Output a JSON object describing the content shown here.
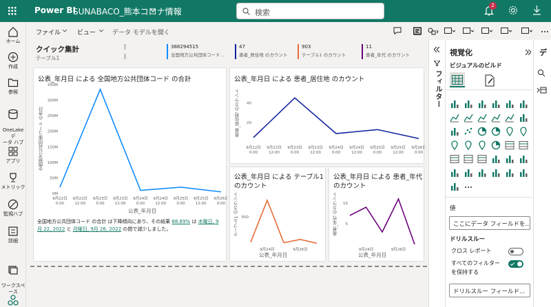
{
  "topbar": {
    "app_name": "Power BI",
    "report_name": "SUNABACO_熊本コロナ情報",
    "search_placeholder": "検索",
    "notification_count": "2"
  },
  "rail": {
    "items": [
      {
        "label": "ホーム"
      },
      {
        "label": "作成"
      },
      {
        "label": "参照"
      },
      {
        "label": "OneLake デ\nータ ハブ"
      },
      {
        "label": "アプリ"
      },
      {
        "label": "メトリック"
      },
      {
        "label": "監視ハブ"
      },
      {
        "label": "詳細"
      },
      {
        "label": "ワークスペ\nース"
      }
    ]
  },
  "cmdbar": {
    "file": "ファイル",
    "view": "ビュー",
    "model": "データ モデルを開く"
  },
  "quick": {
    "title": "クイック集計",
    "subtitle": "テーブル1",
    "kpis": [
      {
        "value": "388294515",
        "label": "全国地方公共団体コード...",
        "color": "#118dff"
      },
      {
        "value": "47",
        "label": "患者_居住地 のカウント",
        "color": "#12239e"
      },
      {
        "value": "903",
        "label": "テーブル1 のカウント",
        "color": "#e66c37"
      },
      {
        "value": "11",
        "label": "患者_年代 のカウント",
        "color": "#6b007b"
      }
    ]
  },
  "charts": {
    "c1": {
      "title": "公表_年月日 による 全国地方公共団体コード の合計",
      "ylabel": "全国地方公共団体コード の合計",
      "xlabel": "公表_年月日",
      "yticks": [
        "350M",
        "300M",
        "250M",
        "200M",
        "150M",
        "100M",
        "50M",
        "0M"
      ],
      "xticks": [
        "9月22日\n0:00",
        "9月22日\n12:00",
        "9月23日\n0:00",
        "9月23日\n12:00",
        "9月24日\n0:00",
        "9月24日\n12:00",
        "9月25日\n0:00",
        "9月25日\n12:00",
        "9月26日\n0:00"
      ]
    },
    "c2": {
      "title": "公表_年月日 による 患者_居住地 のカウント",
      "ylabel": "患者_居住地 のカウント",
      "yticks": [
        "40",
        "20"
      ],
      "xticks": [
        "9月22日\n0:00",
        "9月22日\n12:00",
        "9月23日\n0:00",
        "9月23日\n12:00",
        "9月24日\n0:00",
        "9月24日\n12:00",
        "9月25日\n0:00",
        "9月25日\n12:00",
        "9月26日\n0:00"
      ]
    },
    "c3": {
      "title1": "公表_年月日 による テーブル1",
      "title2": "のカウント",
      "ylabel": "テーブル1 のカウント",
      "xlabel": "公表_年月日",
      "yticks": [
        "500"
      ],
      "xticks": [
        "9月24日",
        "9月26日"
      ]
    },
    "c4": {
      "title1": "公表_年月日 による 患者_年代",
      "title2": "のカウント",
      "ylabel": "患者_年代 のカウント",
      "xlabel": "公表_年月日",
      "yticks": [
        "10",
        "5"
      ],
      "xticks": [
        "9月24日",
        "9月26日"
      ]
    }
  },
  "narrative": {
    "p1": "全国地方公共団体コード の合計 は下降傾向にあり、その結果",
    "pct": "88.89%",
    "p2": "は",
    "d1": "木曜日, 9月 22, 2022",
    "p3": "と",
    "d2": "月曜日, 9月 26, 2022",
    "p4": "の間で減少しました。"
  },
  "filterpane": {
    "label": "フィルター"
  },
  "viz": {
    "title": "視覚化",
    "build": "ビジュアルのビルド",
    "values": "値",
    "values_field": "ここにデータ フィールドを...",
    "drill": "ドリルスルー",
    "cross": "クロス レポート",
    "keepall1": "すべてのフィルター",
    "keepall2": "を保持する",
    "drill_field": "ドリルスルー フィールド...",
    "data_tab": "デ"
  },
  "chart_data": [
    {
      "type": "line",
      "title": "公表_年月日 による 全国地方公共団体コード の合計",
      "x": [
        "9月22日",
        "9月23日",
        "9月24日",
        "9月25日",
        "9月26日"
      ],
      "series": [
        {
          "values": [
            20000000,
            335000000,
            10000000,
            20000000,
            5000000
          ]
        }
      ],
      "ylim": [
        0,
        350000000
      ],
      "color": "#118dff"
    },
    {
      "type": "line",
      "title": "公表_年月日 による 患者_居住地 のカウント",
      "x": [
        "9月22日",
        "9月23日",
        "9月24日",
        "9月25日",
        "9月26日"
      ],
      "series": [
        {
          "values": [
            5,
            45,
            9,
            13,
            4
          ]
        }
      ],
      "color": "#12239e"
    },
    {
      "type": "line",
      "title": "公表_年月日 による テーブル1 のカウント",
      "x": [
        "9月22日",
        "9月23日",
        "9月24日",
        "9月25日",
        "9月26日"
      ],
      "series": [
        {
          "values": [
            40,
            800,
            30,
            90,
            20
          ]
        }
      ],
      "color": "#e66c37"
    },
    {
      "type": "line",
      "title": "公表_年月日 による 患者_年代 のカウント",
      "x": [
        "9月22日",
        "9月23日",
        "9月24日",
        "9月25日",
        "9月26日"
      ],
      "series": [
        {
          "values": [
            7,
            9,
            3,
            11,
            0
          ]
        }
      ],
      "color": "#6b007b"
    }
  ]
}
